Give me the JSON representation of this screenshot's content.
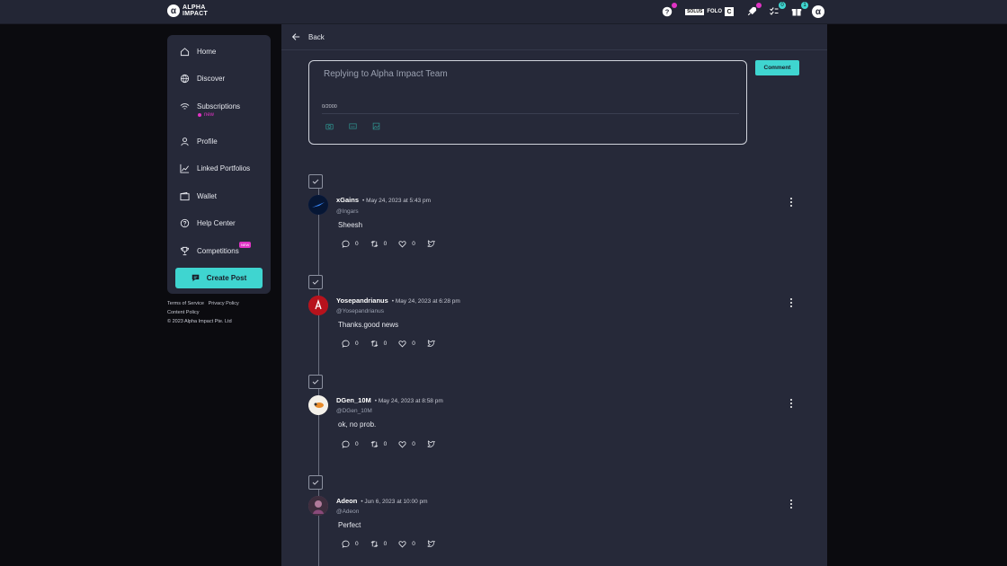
{
  "brand": {
    "line1": "ALPHA",
    "line2": "IMPACT",
    "mark": "α"
  },
  "topbar": {
    "folo_label": "FOLO",
    "folo_box": "SOLUS",
    "notifications_badge_tasks": "0",
    "notifications_badge_gifts": "1",
    "avatar": "α"
  },
  "sidebar": {
    "items": [
      {
        "label": "Home",
        "icon": "home-icon"
      },
      {
        "label": "Discover",
        "icon": "globe-icon"
      },
      {
        "label": "Subscriptions",
        "icon": "wifi-icon",
        "sub": "new"
      },
      {
        "label": "Profile",
        "icon": "user-icon"
      },
      {
        "label": "Linked Portfolios",
        "icon": "chart-icon"
      },
      {
        "label": "Wallet",
        "icon": "wallet-icon"
      },
      {
        "label": "Help Center",
        "icon": "help-icon"
      },
      {
        "label": "Competitions",
        "icon": "trophy-icon",
        "badge": "NEW"
      }
    ],
    "create_post": "Create Post"
  },
  "footer": {
    "terms": "Terms of Service",
    "privacy": "Privacy Policy",
    "content": "Content Policy",
    "copyright": "© 2023 Alpha Impact Pte. Ltd"
  },
  "nav": {
    "back": "Back"
  },
  "reply": {
    "placeholder": "Replying to Alpha Impact Team",
    "count": "0/2000",
    "comment_button": "Comment"
  },
  "posts": [
    {
      "name": "xGains",
      "date": "• May 24, 2023 at 5:43 pm",
      "handle": "@Ingars",
      "text": "Sheesh",
      "comments": "0",
      "reposts": "0",
      "likes": "0",
      "avatar_color": "#0f2a6b"
    },
    {
      "name": "Yosepandrianus",
      "date": "• May 24, 2023 at 6:28 pm",
      "handle": "@Yosepandrianus",
      "text": "Thanks.good news",
      "comments": "0",
      "reposts": "0",
      "likes": "0",
      "avatar_color": "#d0202a"
    },
    {
      "name": "DGen_10M",
      "date": "• May 24, 2023 at 8:58 pm",
      "handle": "@DGen_10M",
      "text": "ok, no prob.",
      "comments": "0",
      "reposts": "0",
      "likes": "0",
      "avatar_color": "#f0eee8"
    },
    {
      "name": "Adeon",
      "date": "• Jun 6, 2023 at 10:00 pm",
      "handle": "@Adeon",
      "text": "Perfect",
      "comments": "0",
      "reposts": "0",
      "likes": "0",
      "avatar_color": "#7a4a6a"
    }
  ]
}
